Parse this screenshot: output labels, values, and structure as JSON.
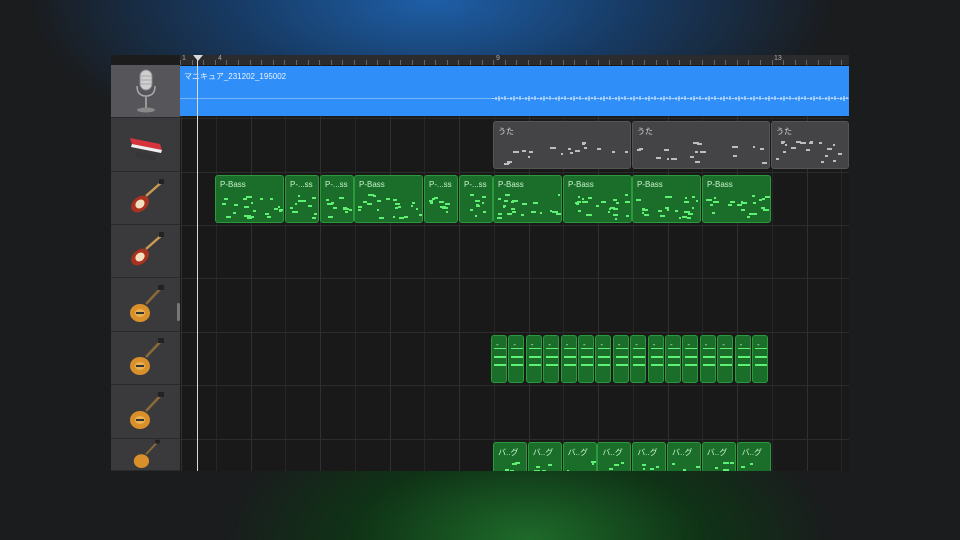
{
  "ruler": {
    "marks": [
      "1",
      "4",
      "9",
      "13"
    ]
  },
  "tracks": [
    {
      "icon": "microphone-icon",
      "instrument": "audio-recorder"
    },
    {
      "icon": "keyboard-icon",
      "instrument": "keyboard"
    },
    {
      "icon": "bass-guitar-icon",
      "instrument": "bass"
    },
    {
      "icon": "bass-guitar-icon",
      "instrument": "bass"
    },
    {
      "icon": "electric-guitar-icon",
      "instrument": "guitar"
    },
    {
      "icon": "electric-guitar-icon",
      "instrument": "guitar"
    },
    {
      "icon": "electric-guitar-icon",
      "instrument": "guitar"
    },
    {
      "icon": "electric-guitar-icon",
      "instrument": "guitar"
    }
  ],
  "audio_region": {
    "label": "マニキュア_231202_195002"
  },
  "regions": {
    "vocal": [
      "うた",
      "うた",
      "うた"
    ],
    "bass": [
      "P-Bass",
      "P-...ss",
      "P-...ss",
      "P-Bass",
      "P-...ss",
      "P-...ss",
      "P-Bass",
      "P-Bass",
      "P-Bass",
      "P-Bass"
    ],
    "guitar1": [
      "-",
      "-",
      "-",
      "-",
      "-",
      "-",
      "-",
      "-",
      "-",
      "-",
      "-",
      "-",
      "-",
      "-",
      "-",
      "-"
    ],
    "guitar2": [
      "バ..グ",
      "バ..グ",
      "バ..グ",
      "バ..グ",
      "バ..グ",
      "バ..グ",
      "バ..グ",
      "バ..グ"
    ]
  },
  "colors": {
    "audio": "#2f8ef7",
    "midi_green": "#1a6e2a",
    "midi_gray": "#444446",
    "note_green": "#5df073"
  }
}
